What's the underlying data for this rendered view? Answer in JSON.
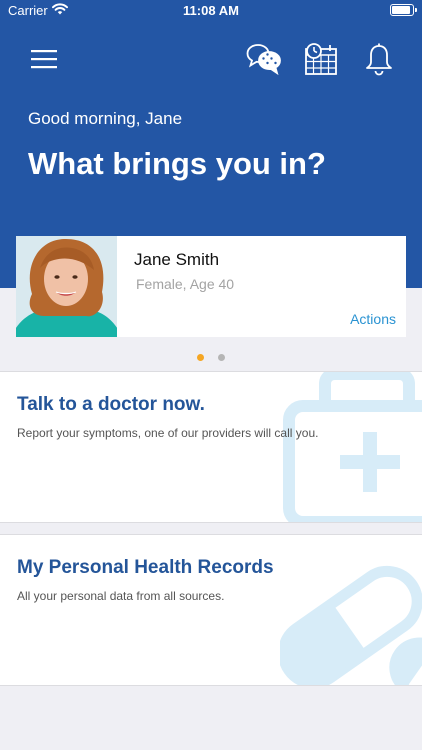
{
  "status_bar": {
    "carrier": "Carrier",
    "time": "11:08 AM"
  },
  "colors": {
    "brand_blue": "#2356a5",
    "link_blue": "#2a93d2",
    "active_dot": "#f5a623",
    "inactive_dot": "#b5b5b5"
  },
  "header": {
    "icons": [
      "hamburger-menu-icon",
      "chat-bubbles-icon",
      "calendar-clock-icon",
      "bell-icon"
    ],
    "greeting": "Good morning, Jane",
    "headline": "What brings you in?"
  },
  "patient_card": {
    "name": "Jane Smith",
    "details": "Female, Age 40",
    "actions_label": "Actions"
  },
  "carousel": {
    "active_index": 0,
    "count": 2
  },
  "tiles": [
    {
      "title": "Talk to a doctor now.",
      "subtitle": "Report your symptoms, one of our providers will call you.",
      "icon": "medical-kit-icon"
    },
    {
      "title": "My Personal Health Records",
      "subtitle": "All your personal data from all sources.",
      "icon": "pills-icon"
    }
  ]
}
